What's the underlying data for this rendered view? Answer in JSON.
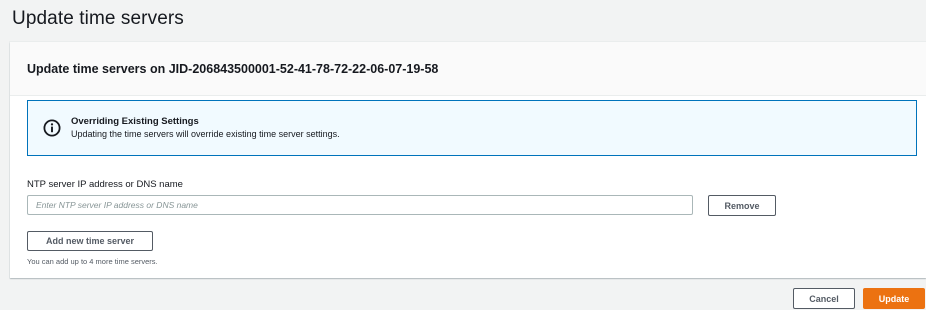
{
  "page": {
    "title": "Update time servers"
  },
  "panel": {
    "header_title": "Update time servers on JID-206843500001-52-41-78-72-22-06-07-19-58"
  },
  "alert": {
    "icon": "info-icon",
    "title": "Overriding Existing Settings",
    "body": "Updating the time servers will override existing time server settings."
  },
  "ntp_field": {
    "label": "NTP server IP address or DNS name",
    "value": "",
    "placeholder": "Enter NTP server IP address or DNS name",
    "remove_label": "Remove"
  },
  "add_server": {
    "label": "Add new time server",
    "hint": "You can add up to 4 more time servers."
  },
  "footer": {
    "cancel_label": "Cancel",
    "update_label": "Update"
  },
  "colors": {
    "primary": "#ec7211",
    "info_border": "#0073bb",
    "info_background": "#f1faff"
  }
}
